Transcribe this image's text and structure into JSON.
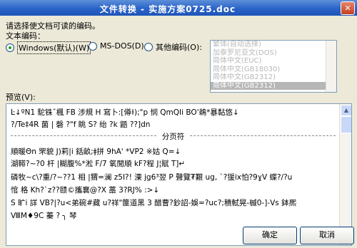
{
  "window": {
    "title": "文件转换 - 实施方案0725.doc",
    "close_glyph": "✕"
  },
  "prompt": "请选择使文档可读的编码。",
  "encoding_label": "文本编码：",
  "radios": [
    {
      "label": "Windows(默认)(W)",
      "checked": true
    },
    {
      "label": "MS-DOS(D)",
      "checked": false
    },
    {
      "label": "其他编码(O):",
      "checked": false
    }
  ],
  "encoding_list": {
    "items": [
      "繁体(自动选择)",
      "加泰罗尼亚文(DOS)",
      "简体中文(EUC)",
      "简体中文(GB18030)",
      "简体中文(GB2312)",
      "简体中文(GB2312)"
    ],
    "selected_index": 5
  },
  "preview_label": "预览(V):",
  "preview": {
    "lines": [
      "Ŀ↓ºΝ1 駝铢ˇ楓 FB 涉規 H 寫卜:[僔ɫ);\"p 悯 QmQIi BO'鵜*暴黏悠↓",
      "?/Te‡4R      菌      |      磬      ?\"f      眺      S?      绐      ?k      鼯      ??]dn"
    ],
    "divider": "分页符",
    "lines2": [
      "順暖Θn 罘貌 J)莉|i 銛畝;ǂ拼 9hA' *VP2 ※姑 Q=↓",
      "湖鞯?~?0 杆 |糊腹%*淞 F/7 氧閒順 kF?程 J¦賦 T]↵",
      "磷牧~c\\?重/?~??1 相   |猬=澜 z5Ⅰ?!  溧 jg6³翌 P 聲覽₮艱 ug, `?猨ix怕?9ɣV 蝶?/?u",
      "悺 格 Kh?`z??赜©攜襄@?X 藁 3?RJ% :>↓",
      "S 旷i 詳 VB?|?u<弟碗#藏 u?祥\"篚道黑 3 醋曹?鈔詔-娛=?uc?;積軾晃-槭0-]-Vs 鉢熈",
      "ⅧM♦9C             蓁             ?             ╮             琴"
    ]
  },
  "buttons": {
    "ok": "确定",
    "cancel": "取消"
  },
  "scroll": {
    "up": "▲",
    "down": "▼",
    "list_up": "▲",
    "list_down": "▼"
  }
}
